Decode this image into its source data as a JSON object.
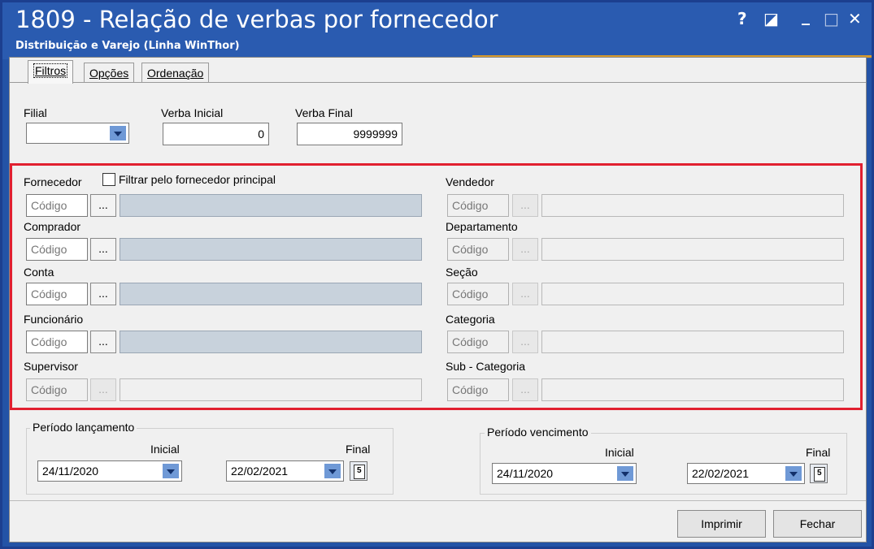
{
  "window": {
    "title": "1809 - Relação de verbas por fornecedor",
    "subtitle": "Distribuição e Varejo (Linha WinThor)",
    "controls": {
      "help": "?",
      "restore": "◪",
      "minimize": "_",
      "maximize": "□",
      "close": "✕"
    }
  },
  "tabs": [
    {
      "label": "Filtros",
      "active": true
    },
    {
      "label": "Opções",
      "active": false
    },
    {
      "label": "Ordenação",
      "active": false
    }
  ],
  "top_filters": {
    "filial_label": "Filial",
    "filial_value": "",
    "verba_inicial_label": "Verba Inicial",
    "verba_inicial_value": "0",
    "verba_final_label": "Verba Final",
    "verba_final_value": "9999999"
  },
  "lookups_left": [
    {
      "label": "Fornecedor",
      "placeholder": "Código",
      "enabled": true
    },
    {
      "label": "Comprador",
      "placeholder": "Código",
      "enabled": true
    },
    {
      "label": "Conta",
      "placeholder": "Código",
      "enabled": true
    },
    {
      "label": "Funcionário",
      "placeholder": "Código",
      "enabled": true
    },
    {
      "label": "Supervisor",
      "placeholder": "Código",
      "enabled": false
    }
  ],
  "lookups_right": [
    {
      "label": "Vendedor",
      "placeholder": "Código",
      "enabled": false
    },
    {
      "label": "Departamento",
      "placeholder": "Código",
      "enabled": false
    },
    {
      "label": "Seção",
      "placeholder": "Código",
      "enabled": false
    },
    {
      "label": "Categoria",
      "placeholder": "Código",
      "enabled": false
    },
    {
      "label": "Sub - Categoria",
      "placeholder": "Código",
      "enabled": false
    }
  ],
  "lookup_button_label": "...",
  "checkbox_fornecedor_principal": {
    "label": "Filtrar pelo fornecedor principal",
    "checked": false
  },
  "periodo_lancamento": {
    "title": "Período lançamento",
    "inicial_label": "Inicial",
    "inicial_value": "24/11/2020",
    "final_label": "Final",
    "final_value": "22/02/2021"
  },
  "periodo_vencimento": {
    "title": "Período vencimento",
    "inicial_label": "Inicial",
    "inicial_value": "24/11/2020",
    "final_label": "Final",
    "final_value": "22/02/2021"
  },
  "buttons": {
    "imprimir": "Imprimir",
    "fechar": "Fechar"
  },
  "colors": {
    "titlebar": "#2a5bb0",
    "highlight_border": "#e12030",
    "accent_line": "#d89a2a"
  }
}
